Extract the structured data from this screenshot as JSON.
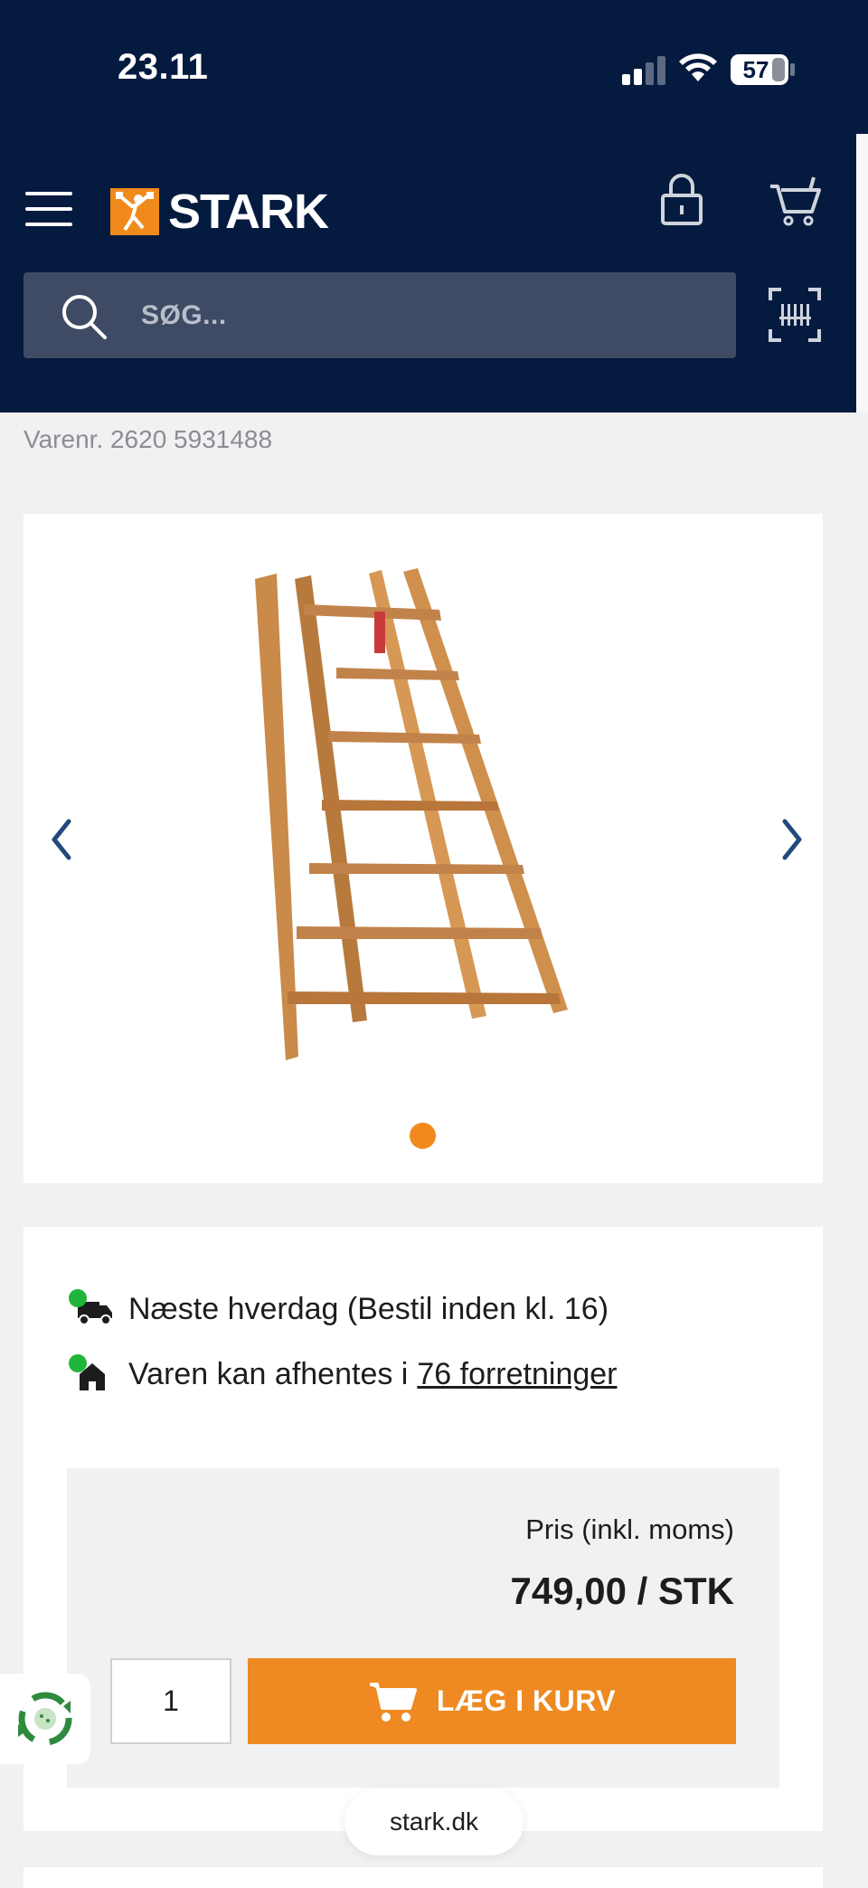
{
  "status_bar": {
    "time": "23.11",
    "battery": "57"
  },
  "header": {
    "logo_text": "STARK",
    "search_placeholder": "SØG..."
  },
  "product": {
    "item_number": "Varenr. 2620 5931488"
  },
  "delivery": {
    "shipping_text": "Næste hverdag (Bestil inden kl. 16)",
    "pickup_prefix": "Varen kan afhentes i",
    "pickup_link": "76 forretninger"
  },
  "price": {
    "label": "Pris (inkl. moms)",
    "value": "749,00 / STK"
  },
  "cart": {
    "quantity": "1",
    "add_label": "LÆG I KURV"
  },
  "browser": {
    "url": "stark.dk"
  },
  "colors": {
    "navy": "#041b3f",
    "accent": "#f08a1d",
    "available": "#1fb53a"
  }
}
